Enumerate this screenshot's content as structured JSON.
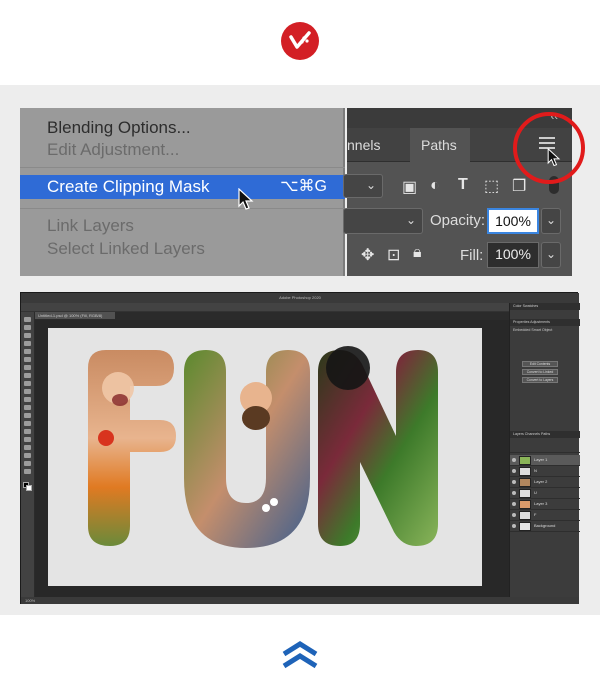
{
  "branding": {
    "logo_icon": "brand-logo-icon",
    "accent": "#d31f25",
    "chevron_color": "#1e63b8"
  },
  "menu": {
    "items": [
      {
        "label": "Blending Options...",
        "state": "normal"
      },
      {
        "label": "Edit Adjustment...",
        "state": "disabled"
      },
      {
        "label": "Create Clipping Mask",
        "state": "highlighted",
        "shortcut": "⌥⌘G"
      },
      {
        "label": "Link Layers",
        "state": "disabled"
      },
      {
        "label": "Select Linked Layers",
        "state": "disabled"
      }
    ]
  },
  "panel": {
    "tab_channels": "nnels",
    "tab_paths": "Paths",
    "collapse_glyph": "‹‹",
    "opacity_label": "Opacity:",
    "opacity_value": "100%",
    "fill_label": "Fill:",
    "fill_value": "100%"
  },
  "photoshop": {
    "title": "Adobe Photoshop 2020",
    "doc_tab": "Untitled-1.psd @ 100% (Fill, RGB/8)",
    "status": "100%",
    "canvas_word": "FUN",
    "properties_tabs": "Properties  Adjustments",
    "properties_title": "Embedded Smart Object",
    "buttons": [
      "Edit Contents",
      "Convert to Linked",
      "Convert to Layers"
    ],
    "layers_tabs": "Layers  Channels  Paths",
    "layers": [
      {
        "name": "Layer 1",
        "selected": true
      },
      {
        "name": "N",
        "selected": false
      },
      {
        "name": "Layer 2",
        "selected": false
      },
      {
        "name": "U",
        "selected": false
      },
      {
        "name": "Layer 3",
        "selected": false
      },
      {
        "name": "F",
        "selected": false
      },
      {
        "name": "Background",
        "selected": false
      }
    ]
  }
}
